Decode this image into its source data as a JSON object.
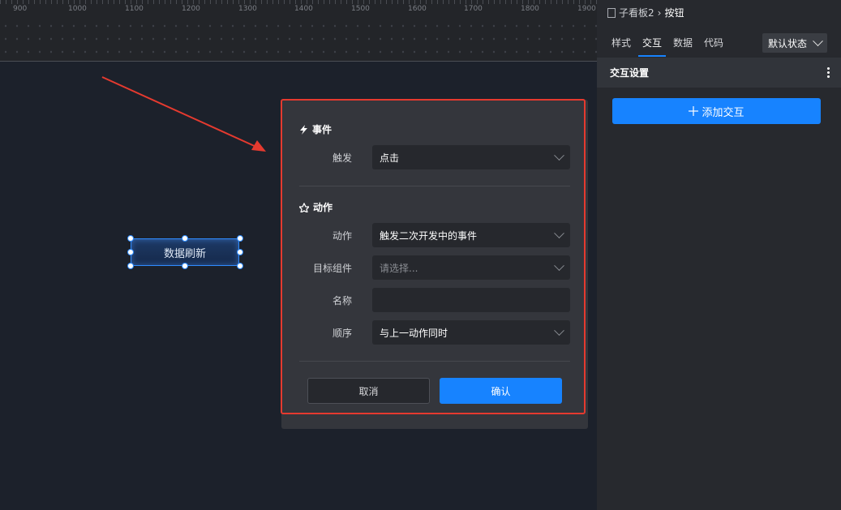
{
  "ruler": {
    "ticks": [
      "900",
      "1000",
      "1100",
      "1200",
      "1300",
      "1400",
      "1500",
      "1600",
      "1700",
      "1800",
      "1900"
    ]
  },
  "canvas": {
    "widget_label": "数据刷新"
  },
  "modal": {
    "event_section": {
      "title": "事件",
      "trigger_label": "触发",
      "trigger_value": "点击"
    },
    "action_section": {
      "title": "动作",
      "action_label": "动作",
      "action_value": "触发二次开发中的事件",
      "target_label": "目标组件",
      "target_placeholder": "请选择...",
      "name_label": "名称",
      "name_value": "",
      "order_label": "顺序",
      "order_value": "与上一动作同时"
    },
    "cancel_label": "取消",
    "confirm_label": "确认"
  },
  "panel": {
    "breadcrumb": {
      "parent": "子看板2",
      "current": "按钮"
    },
    "tabs": [
      {
        "label": "样式"
      },
      {
        "label": "交互"
      },
      {
        "label": "数据"
      },
      {
        "label": "代码"
      }
    ],
    "active_tab": "交互",
    "state_select": "默认状态",
    "section_title": "交互设置",
    "add_button": "添加交互"
  },
  "colors": {
    "accent": "#1783ff",
    "highlight": "#e53a2f"
  }
}
